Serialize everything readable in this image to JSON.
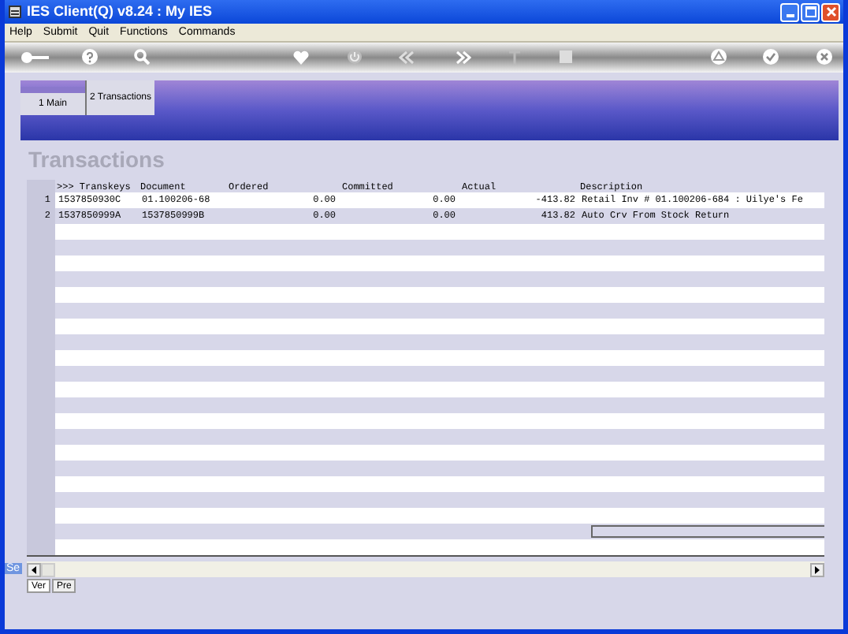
{
  "window": {
    "title": "IES Client(Q) v8.24 : My IES"
  },
  "menu": [
    "Help",
    "Submit",
    "Quit",
    "Functions",
    "Commands"
  ],
  "tabs": [
    {
      "label": "1 Main",
      "selected": false
    },
    {
      "label": "2 Transactions",
      "selected": true
    }
  ],
  "heading": "Transactions",
  "table": {
    "columns": [
      ">>> Transkeys",
      "Document",
      "Ordered",
      "Committed",
      "Actual",
      "Description"
    ],
    "rows": [
      {
        "number": "1",
        "cells": [
          "1537850930C",
          "01.100206-68",
          "0.00",
          "0.00",
          "-413.82",
          "Retail Inv # 01.100206-684 : Uilye's Fe"
        ]
      },
      {
        "number": "2",
        "cells": [
          "1537850999A",
          "1537850999B",
          "0.00",
          "0.00",
          "413.82",
          "Auto Crv From Stock Return"
        ]
      }
    ]
  },
  "side_label": "Se",
  "bottom_tabs": [
    {
      "label": "Ver",
      "selected": true
    },
    {
      "label": "Pre",
      "selected": false
    }
  ]
}
